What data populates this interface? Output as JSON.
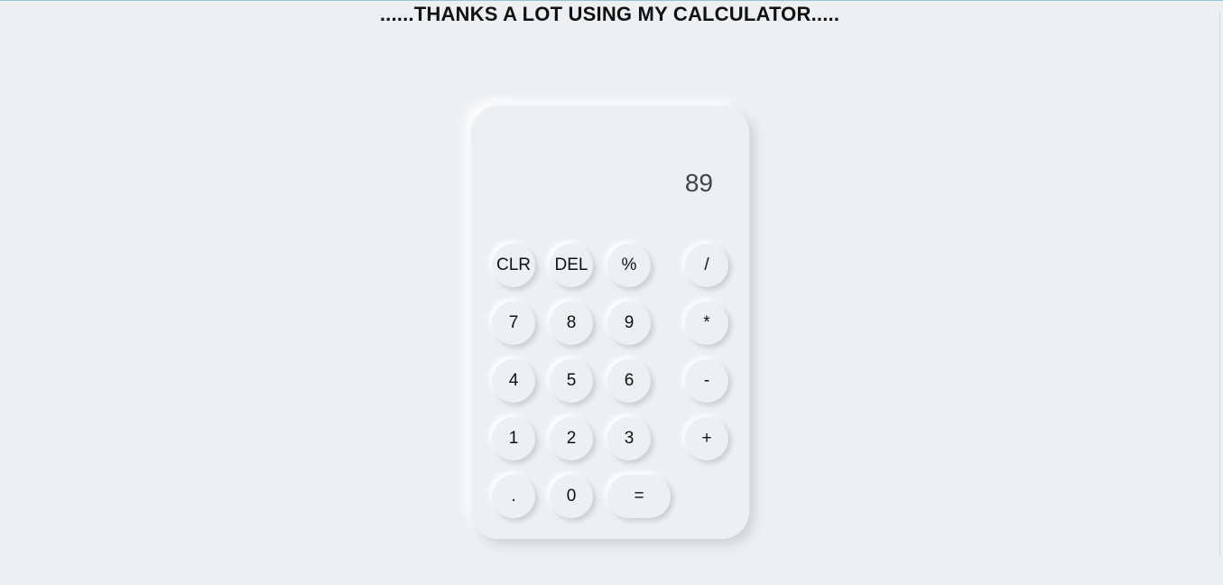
{
  "page": {
    "title": "......THANKS A LOT USING MY CALCULATOR....."
  },
  "calculator": {
    "display": "89",
    "buttons": {
      "clr": "CLR",
      "del": "DEL",
      "percent": "%",
      "divide": "/",
      "seven": "7",
      "eight": "8",
      "nine": "9",
      "multiply": "*",
      "four": "4",
      "five": "5",
      "six": "6",
      "minus": "-",
      "one": "1",
      "two": "2",
      "three": "3",
      "plus": "+",
      "dot": ".",
      "zero": "0",
      "equals": "="
    }
  },
  "colors": {
    "background": "#ecf0f3",
    "text": "#111111",
    "display_text": "#444444"
  }
}
